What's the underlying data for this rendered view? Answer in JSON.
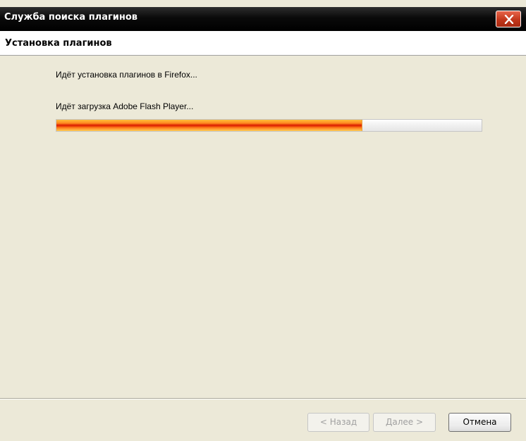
{
  "window": {
    "title": "Служба поиска плагинов",
    "close_icon": "close-icon"
  },
  "header": {
    "heading": "Установка плагинов"
  },
  "main": {
    "status_install": "Идёт установка плагинов в Firefox...",
    "status_download": "Идёт загрузка Adobe Flash Player...",
    "progress_percent": 72,
    "progress_colors": {
      "fill_core": "#d91a00",
      "fill_edge": "#ffbe3a"
    }
  },
  "footer": {
    "back_label": "< Назад",
    "next_label": "Далее >",
    "cancel_label": "Отмена"
  },
  "colors": {
    "titlebar": "#000000",
    "close_button": "#c2371b",
    "panel": "#ece9d8"
  }
}
